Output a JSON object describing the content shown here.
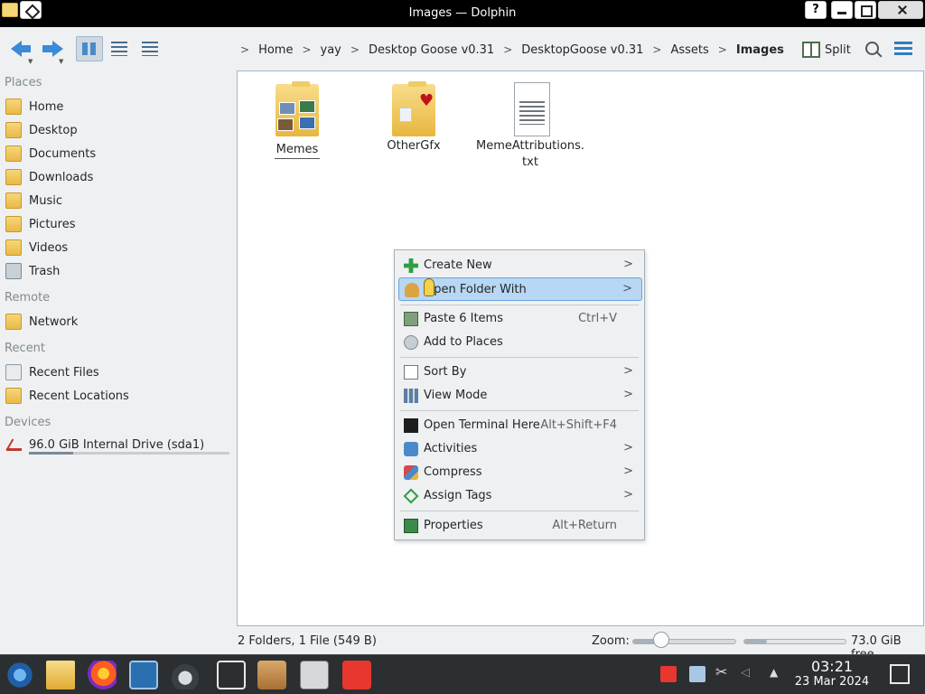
{
  "window": {
    "title": "Images — Dolphin",
    "help_label": "?"
  },
  "toolbar": {
    "breadcrumb": [
      "Home",
      "yay",
      "Desktop Goose v0.31",
      "DesktopGoose v0.31",
      "Assets",
      "Images"
    ],
    "separator": ">",
    "split_label": "Split"
  },
  "sidebar": {
    "places_heading": "Places",
    "places": [
      {
        "label": "Home",
        "icon": "home-folder-icon"
      },
      {
        "label": "Desktop",
        "icon": "desktop-folder-icon"
      },
      {
        "label": "Documents",
        "icon": "documents-folder-icon"
      },
      {
        "label": "Downloads",
        "icon": "downloads-folder-icon"
      },
      {
        "label": "Music",
        "icon": "music-folder-icon"
      },
      {
        "label": "Pictures",
        "icon": "pictures-folder-icon"
      },
      {
        "label": "Videos",
        "icon": "videos-folder-icon"
      },
      {
        "label": "Trash",
        "icon": "trash-icon"
      }
    ],
    "remote_heading": "Remote",
    "remote": [
      {
        "label": "Network",
        "icon": "network-folder-icon"
      }
    ],
    "recent_heading": "Recent",
    "recent": [
      {
        "label": "Recent Files",
        "icon": "recent-files-icon"
      },
      {
        "label": "Recent Locations",
        "icon": "recent-locations-icon"
      }
    ],
    "devices_heading": "Devices",
    "devices": [
      {
        "label": "96.0 GiB Internal Drive (sda1)",
        "icon": "drive-icon",
        "used_fraction": 0.22
      }
    ]
  },
  "files": [
    {
      "name": "Memes",
      "type": "folder",
      "focused": true
    },
    {
      "name": "OtherGfx",
      "type": "folder",
      "focused": false
    },
    {
      "name": "MemeAttributions.\ntxt",
      "type": "text-file",
      "focused": false
    }
  ],
  "context_menu": {
    "items": [
      {
        "label": "Create New",
        "shortcut": "",
        "submenu": true,
        "icon": "create-new-icon"
      },
      {
        "label": "Open Folder With",
        "shortcut": "",
        "submenu": true,
        "icon": "open-with-icon",
        "highlighted": true
      },
      {
        "label": "Paste 6 Items",
        "shortcut": "Ctrl+V",
        "submenu": false,
        "icon": "paste-icon"
      },
      {
        "label": "Add to Places",
        "shortcut": "",
        "submenu": false,
        "icon": "add-to-places-icon"
      },
      {
        "label": "Sort By",
        "shortcut": "",
        "submenu": true,
        "icon": "sort-icon"
      },
      {
        "label": "View Mode",
        "shortcut": "",
        "submenu": true,
        "icon": "view-mode-icon"
      },
      {
        "label": "Open Terminal Here",
        "shortcut": "Alt+Shift+F4",
        "submenu": false,
        "icon": "terminal-icon"
      },
      {
        "label": "Activities",
        "shortcut": "",
        "submenu": true,
        "icon": "activities-icon"
      },
      {
        "label": "Compress",
        "shortcut": "",
        "submenu": true,
        "icon": "compress-icon"
      },
      {
        "label": "Assign Tags",
        "shortcut": "",
        "submenu": true,
        "icon": "tag-icon"
      },
      {
        "label": "Properties",
        "shortcut": "Alt+Return",
        "submenu": false,
        "icon": "properties-icon"
      }
    ],
    "submenu_arrow": ">"
  },
  "statusbar": {
    "summary": "2 Folders, 1 File (549 B)",
    "zoom_label": "Zoom:",
    "zoom_fraction": 0.28,
    "free_fraction": 0.22,
    "free_text": "73.0 GiB free"
  },
  "taskbar": {
    "apps": [
      "start-menu-icon",
      "file-manager-icon",
      "firefox-icon",
      "system-settings-icon",
      "desktop-goose-icon",
      "window-switcher-icon",
      "package-icon",
      "x-terminal-icon",
      "anydesk-icon"
    ],
    "clock": {
      "time": "03:21",
      "date": "23 Mar 2024"
    }
  }
}
